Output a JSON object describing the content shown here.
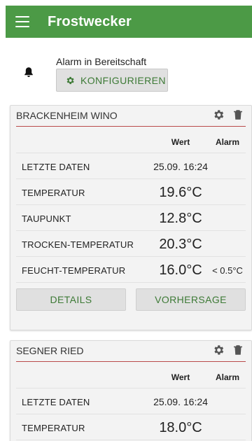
{
  "appbar": {
    "title": "Frostwecker",
    "menu_icon": "menu-icon"
  },
  "alarm": {
    "status_text": "Alarm in Bereitschaft",
    "config_label": "KONFIGURIEREN",
    "bell_icon": "bell-icon",
    "gear_icon": "gear-icon"
  },
  "colors": {
    "appbar": "#4c9a46",
    "accent_text": "#3d7a36",
    "title_underline": "#b94a4a"
  },
  "stations": [
    {
      "name": "BRACKENHEIM WINO",
      "columns": {
        "value": "Wert",
        "alarm": "Alarm"
      },
      "rows": [
        {
          "label": "LETZTE DATEN",
          "value": "25.09. 16:24",
          "alarm": ""
        },
        {
          "label": "TEMPERATUR",
          "value": "19.6°C",
          "alarm": ""
        },
        {
          "label": "TAUPUNKT",
          "value": "12.8°C",
          "alarm": ""
        },
        {
          "label": "TROCKEN-TEMPERATUR",
          "value": "20.3°C",
          "alarm": ""
        },
        {
          "label": "FEUCHT-TEMPERATUR",
          "value": "16.0°C",
          "alarm": "< 0.5°C"
        }
      ],
      "buttons": {
        "details": "DETAILS",
        "forecast": "VORHERSAGE"
      }
    },
    {
      "name": "SEGNER RIED",
      "columns": {
        "value": "Wert",
        "alarm": "Alarm"
      },
      "rows": [
        {
          "label": "LETZTE DATEN",
          "value": "25.09. 16:24",
          "alarm": ""
        },
        {
          "label": "TEMPERATUR",
          "value": "18.0°C",
          "alarm": ""
        }
      ]
    }
  ]
}
